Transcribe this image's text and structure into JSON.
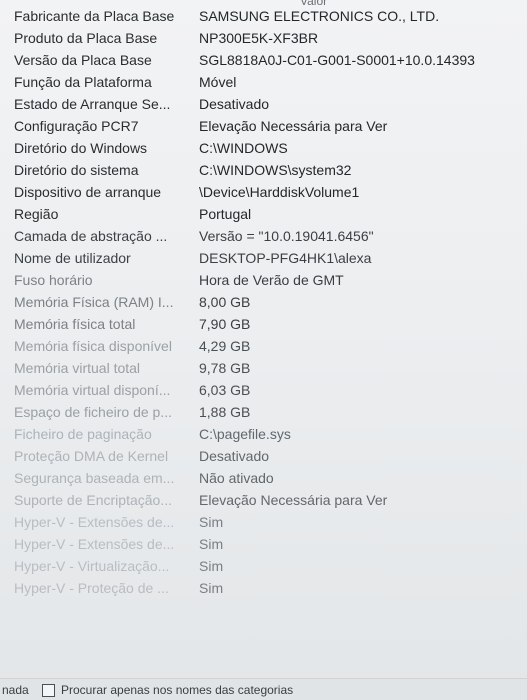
{
  "column_header": "Valor",
  "rows": [
    {
      "item": "Fabricante da Placa Base",
      "value": "SAMSUNG ELECTRONICS CO., LTD."
    },
    {
      "item": "Produto da Placa Base",
      "value": "NP300E5K-XF3BR"
    },
    {
      "item": "Versão da Placa Base",
      "value": "SGL8818A0J-C01-G001-S0001+10.0.14393"
    },
    {
      "item": "Função da Plataforma",
      "value": "Móvel"
    },
    {
      "item": "Estado de Arranque Se...",
      "value": "Desativado"
    },
    {
      "item": "Configuração PCR7",
      "value": "Elevação Necessária para Ver"
    },
    {
      "item": "Diretório do Windows",
      "value": "C:\\WINDOWS"
    },
    {
      "item": "Diretório do sistema",
      "value": "C:\\WINDOWS\\system32"
    },
    {
      "item": "Dispositivo de arranque",
      "value": "\\Device\\HarddiskVolume1"
    },
    {
      "item": "Região",
      "value": "Portugal"
    },
    {
      "item": "Camada de abstração ...",
      "value": "Versão = \"10.0.19041.6456\""
    },
    {
      "item": "Nome de utilizador",
      "value": "DESKTOP-PFG4HK1\\alexa"
    },
    {
      "item": "Fuso horário",
      "value": "Hora de Verão de GMT"
    },
    {
      "item": "Memória Física (RAM) I...",
      "value": "8,00 GB"
    },
    {
      "item": "Memória física total",
      "value": "7,90 GB"
    },
    {
      "item": "Memória física disponível",
      "value": "4,29 GB"
    },
    {
      "item": "Memória virtual total",
      "value": "9,78 GB"
    },
    {
      "item": "Memória virtual disponí...",
      "value": "6,03 GB"
    },
    {
      "item": "Espaço de ficheiro de p...",
      "value": "1,88 GB"
    },
    {
      "item": "Ficheiro de paginação",
      "value": "C:\\pagefile.sys"
    },
    {
      "item": "Proteção DMA de Kernel",
      "value": "Desativado"
    },
    {
      "item": "Segurança baseada em...",
      "value": "Não ativado"
    },
    {
      "item": "Suporte de Encriptação...",
      "value": "Elevação Necessária para Ver"
    },
    {
      "item": "Hyper-V - Extensões de...",
      "value": "Sim"
    },
    {
      "item": "Hyper-V - Extensões de...",
      "value": "Sim"
    },
    {
      "item": "Hyper-V - Virtualização...",
      "value": "Sim"
    },
    {
      "item": "Hyper-V - Proteção de ...",
      "value": "Sim"
    }
  ],
  "bottom_bar": {
    "cut_label": "nada",
    "search_categories_label": "Procurar apenas nos nomes das categorias"
  }
}
